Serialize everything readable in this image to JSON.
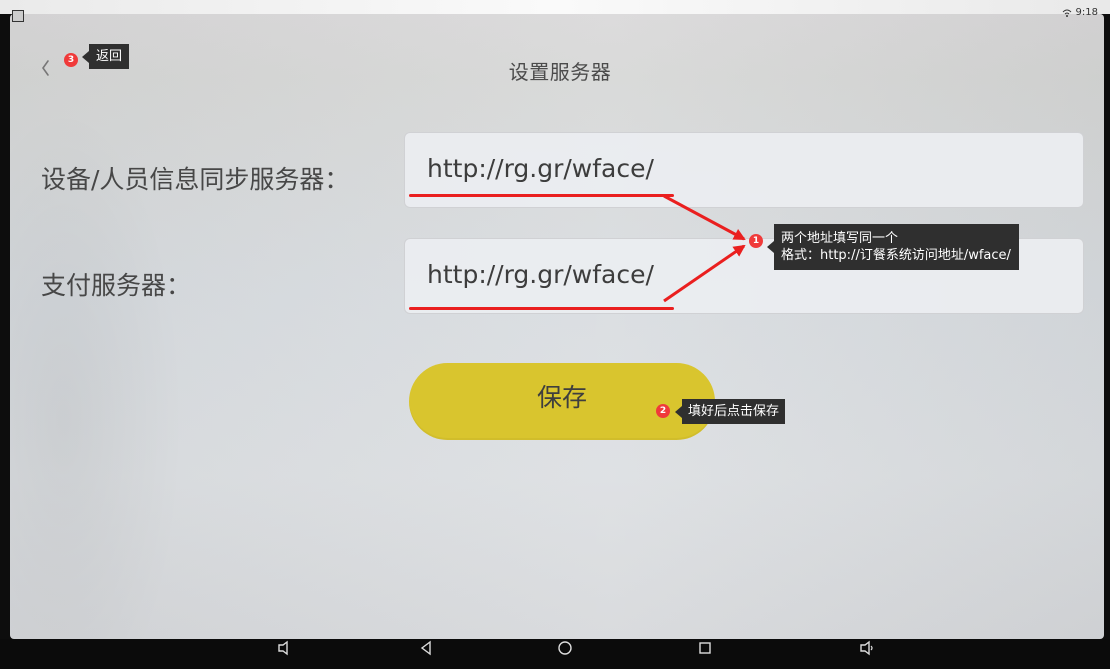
{
  "status_bar": {
    "time": "9:18"
  },
  "header": {
    "back_icon": "chevron-left-icon",
    "title": "设置服务器"
  },
  "form": {
    "sync_server": {
      "label": "设备/人员信息同步服务器：",
      "value": "http://rg.gr/wface/"
    },
    "payment_server": {
      "label": "支付服务器：",
      "value": "http://rg.gr/wface/"
    },
    "save_label": "保存"
  },
  "annotations": {
    "back": {
      "badge": "3",
      "text": "返回"
    },
    "instruction": {
      "badge": "1",
      "line1": "两个地址填写同一个",
      "line2": "格式：http://订餐系统访问地址/wface/"
    },
    "save": {
      "badge": "2",
      "text": "填好后点击保存"
    }
  },
  "colors": {
    "annotation_red": "#ea1f1f",
    "callout_background": "#2f2f2f",
    "save_button": "#d9c52e"
  }
}
